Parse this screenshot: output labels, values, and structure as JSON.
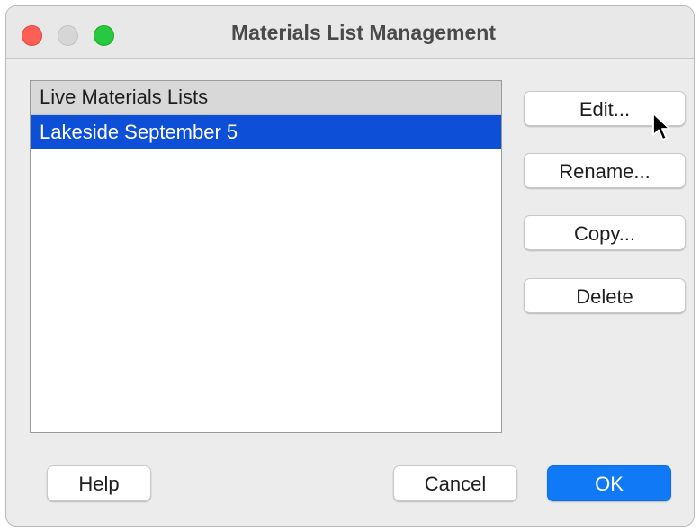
{
  "window": {
    "title": "Materials List Management"
  },
  "list": {
    "header": "Live Materials Lists",
    "items": [
      {
        "label": "Lakeside September 5",
        "selected": true
      }
    ]
  },
  "actions": {
    "edit_label": "Edit...",
    "rename_label": "Rename...",
    "copy_label": "Copy...",
    "delete_label": "Delete"
  },
  "footer": {
    "help_label": "Help",
    "cancel_label": "Cancel",
    "ok_label": "OK"
  },
  "colors": {
    "selection": "#0e4fd8",
    "primary_button": "#1079f5",
    "close": "#fe5f57",
    "zoom": "#28c840"
  },
  "icons": {
    "pointer": "mouse-pointer-icon"
  }
}
